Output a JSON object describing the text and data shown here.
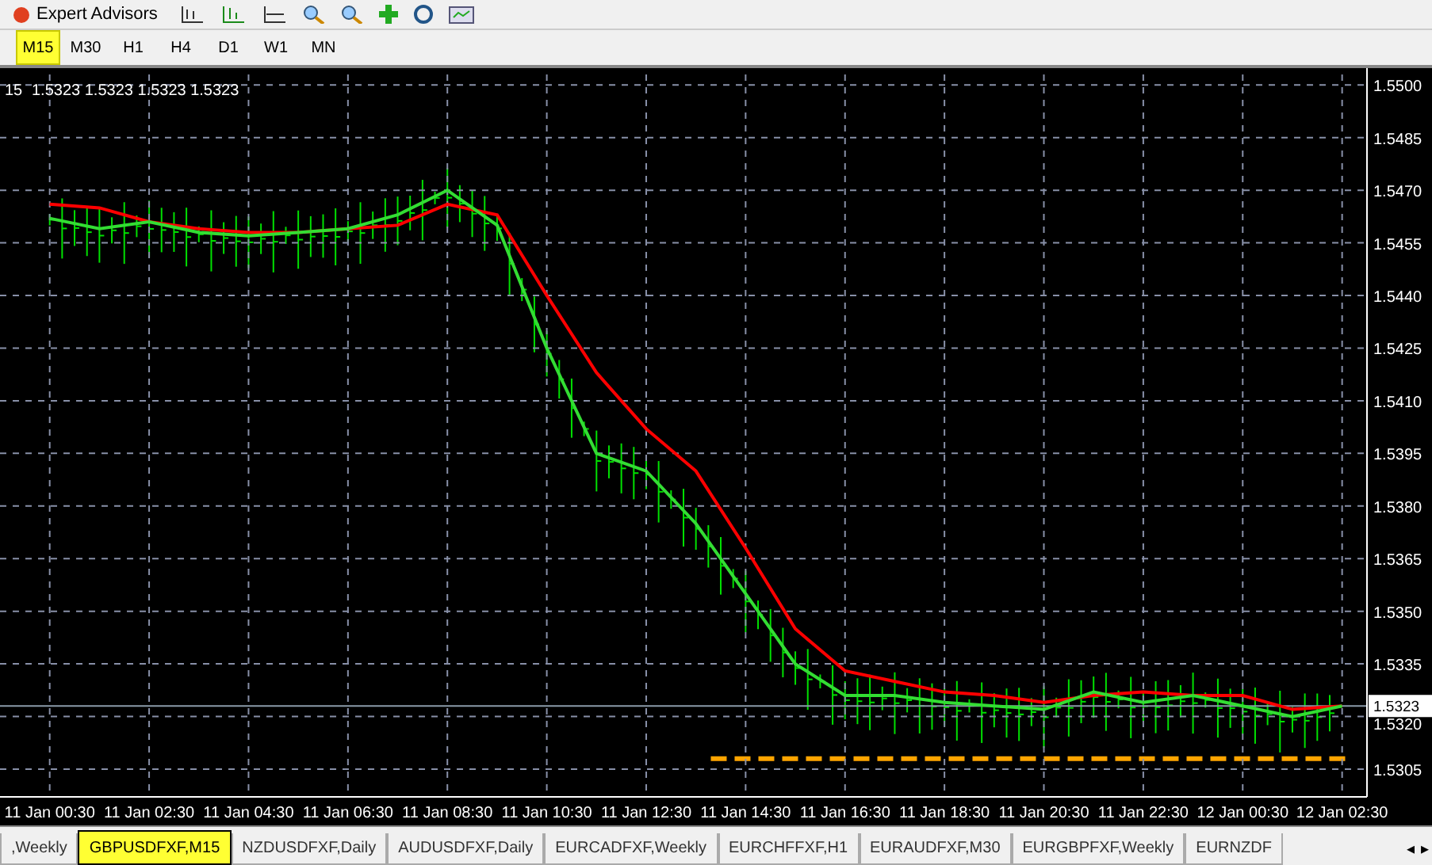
{
  "toolbar": {
    "label": "Expert Advisors"
  },
  "timeframes": [
    {
      "label": "M15",
      "selected": true
    },
    {
      "label": "M30",
      "selected": false
    },
    {
      "label": "H1",
      "selected": false
    },
    {
      "label": "H4",
      "selected": false
    },
    {
      "label": "D1",
      "selected": false
    },
    {
      "label": "W1",
      "selected": false
    },
    {
      "label": "MN",
      "selected": false
    }
  ],
  "chart": {
    "header": {
      "symbol": "15",
      "values": [
        "1.5323",
        "1.5323",
        "1.5323",
        "1.5323"
      ]
    },
    "price_label": "1.5323",
    "chart_data": {
      "type": "line",
      "categories": [
        "11 Jan 00:30",
        null,
        "11 Jan 02:30",
        null,
        "11 Jan 04:30",
        null,
        "11 Jan 06:30",
        null,
        "11 Jan 08:30",
        null,
        "11 Jan 10:30",
        null,
        "11 Jan 12:30",
        null,
        "11 Jan 14:30",
        null,
        "11 Jan 16:30",
        null,
        "11 Jan 18:30",
        null,
        "11 Jan 20:30",
        null,
        "11 Jan 22:30",
        null,
        "12 Jan 00:30",
        null,
        "12 Jan 02:30"
      ],
      "series": [
        {
          "color": "#ff0000",
          "values": [
            1.5466,
            1.5465,
            1.5461,
            1.5459,
            1.5458,
            1.5458,
            1.5459,
            1.546,
            1.5466,
            1.5463,
            1.544,
            1.5418,
            1.5402,
            1.539,
            1.5368,
            1.5345,
            1.5333,
            1.533,
            1.5327,
            1.5326,
            1.5324,
            1.5326,
            1.5327,
            1.5326,
            1.5326,
            1.5322,
            1.5323
          ]
        },
        {
          "color": "#33dd33",
          "values": [
            1.5462,
            1.5459,
            1.5461,
            1.5458,
            1.5457,
            1.5458,
            1.5459,
            1.5463,
            1.547,
            1.546,
            1.5425,
            1.5395,
            1.539,
            1.5375,
            1.5355,
            1.5335,
            1.5326,
            1.5326,
            1.5324,
            1.5323,
            1.5322,
            1.5327,
            1.5324,
            1.5326,
            1.5323,
            1.532,
            1.5323
          ]
        }
      ],
      "ylim": [
        1.5298,
        1.5503
      ],
      "grid": true,
      "yticks": [
        {
          "value": 1.5305,
          "label": "1.5305"
        },
        {
          "value": 1.532,
          "label": "1.5320"
        },
        {
          "value": 1.5335,
          "label": "1.5335"
        },
        {
          "value": 1.535,
          "label": "1.5350"
        },
        {
          "value": 1.5365,
          "label": "1.5365"
        },
        {
          "value": 1.538,
          "label": "1.5380"
        },
        {
          "value": 1.5395,
          "label": "1.5395"
        },
        {
          "value": 1.541,
          "label": "1.5410"
        },
        {
          "value": 1.5425,
          "label": "1.5425"
        },
        {
          "value": 1.544,
          "label": "1.5440"
        },
        {
          "value": 1.5455,
          "label": "1.5455"
        },
        {
          "value": 1.547,
          "label": "1.5470"
        },
        {
          "value": 1.5485,
          "label": "1.5485"
        },
        {
          "value": 1.55,
          "label": "1.5500"
        }
      ]
    }
  },
  "symbol_tabs": [
    {
      "label": ",Weekly",
      "selected": false
    },
    {
      "label": "GBPUSDFXF,M15",
      "selected": true
    },
    {
      "label": "NZDUSDFXF,Daily",
      "selected": false
    },
    {
      "label": "AUDUSDFXF,Daily",
      "selected": false
    },
    {
      "label": "EURCADFXF,Weekly",
      "selected": false
    },
    {
      "label": "EURCHFFXF,H1",
      "selected": false
    },
    {
      "label": "EURAUDFXF,M30",
      "selected": false
    },
    {
      "label": "EURGBPFXF,Weekly",
      "selected": false
    },
    {
      "label": "EURNZDF",
      "selected": false
    }
  ],
  "tab_arrows": [
    "◂",
    "▸"
  ]
}
